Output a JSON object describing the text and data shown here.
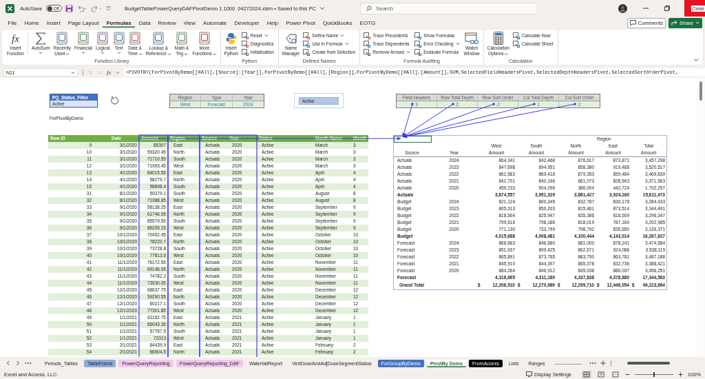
{
  "title_bar": {
    "autosave": {
      "label": "AutoSave",
      "on": false,
      "state": "Off"
    },
    "document_title": "BudgetTablePowerQueryDAFPivotDemo 1.1000  04272024.xlsm • Saved to this PC",
    "search": {
      "placeholder": "Search"
    },
    "close_label": "Close"
  },
  "menu": {
    "tabs": [
      {
        "label": "File",
        "selected": false
      },
      {
        "label": "Home",
        "selected": false
      },
      {
        "label": "Insert",
        "selected": false
      },
      {
        "label": "Page Layout",
        "selected": false
      },
      {
        "label": "Formulas",
        "selected": true
      },
      {
        "label": "Data",
        "selected": false
      },
      {
        "label": "Review",
        "selected": false
      },
      {
        "label": "View",
        "selected": false
      },
      {
        "label": "Automate",
        "selected": false
      },
      {
        "label": "Developer",
        "selected": false
      },
      {
        "label": "Help",
        "selected": false
      },
      {
        "label": "Power Pivot",
        "selected": false
      },
      {
        "label": "QuickBooks",
        "selected": false
      },
      {
        "label": "EOTG",
        "selected": false
      }
    ],
    "comments": "Comments",
    "share": "Share"
  },
  "ribbon": {
    "groups": [
      {
        "label": "Function Library",
        "items": [
          {
            "kind": "large",
            "lines": [
              "Insert",
              "Function"
            ],
            "dropdown": false,
            "icon_text": "fx"
          },
          {
            "kind": "large",
            "lines": [
              "AutoSum"
            ],
            "dropdown": true
          },
          {
            "kind": "large",
            "lines": [
              "Recently",
              "Used"
            ],
            "dropdown": true
          },
          {
            "kind": "large",
            "lines": [
              "Financial"
            ],
            "dropdown": true
          },
          {
            "kind": "large",
            "lines": [
              "Logical"
            ],
            "dropdown": true
          },
          {
            "kind": "large",
            "lines": [
              "Text"
            ],
            "dropdown": true
          },
          {
            "kind": "large",
            "lines": [
              "Date &",
              "Time"
            ],
            "dropdown": true
          },
          {
            "kind": "large",
            "lines": [
              "Lookup &",
              "Reference"
            ],
            "dropdown": true
          },
          {
            "kind": "large",
            "lines": [
              "Math &",
              "Trig"
            ],
            "dropdown": true
          },
          {
            "kind": "large",
            "lines": [
              "More",
              "Functions"
            ],
            "dropdown": true
          }
        ]
      },
      {
        "label": "Python",
        "items": [
          {
            "kind": "large",
            "lines": [
              "Insert",
              "Python"
            ],
            "dropdown": false
          },
          {
            "kind": "column",
            "buttons": [
              {
                "label": "Reset",
                "dropdown": true
              },
              {
                "label": "Diagnostics",
                "dropdown": false
              },
              {
                "label": "Initialization",
                "dropdown": false
              }
            ]
          }
        ]
      },
      {
        "label": "Defined Names",
        "items": [
          {
            "kind": "large",
            "lines": [
              "Name",
              "Manager"
            ],
            "dropdown": false
          },
          {
            "kind": "column",
            "buttons": [
              {
                "label": "Define Name",
                "dropdown": true
              },
              {
                "label": "Use in Formula",
                "dropdown": true
              },
              {
                "label": "Create from Selection",
                "dropdown": false
              }
            ]
          }
        ]
      },
      {
        "label": "Formula Auditing",
        "items": [
          {
            "kind": "column",
            "buttons": [
              {
                "label": "Trace Precedents",
                "dropdown": false
              },
              {
                "label": "Trace Dependents",
                "dropdown": false
              },
              {
                "label": "Remove Arrows",
                "dropdown": true
              }
            ]
          },
          {
            "kind": "column",
            "buttons": [
              {
                "label": "Show Formulas",
                "dropdown": false
              },
              {
                "label": "Error Checking",
                "dropdown": true
              },
              {
                "label": "Evaluate Formula",
                "dropdown": false
              }
            ]
          },
          {
            "kind": "large",
            "lines": [
              "Watch",
              "Window"
            ],
            "dropdown": false
          }
        ]
      },
      {
        "label": "Calculation",
        "items": [
          {
            "kind": "large",
            "lines": [
              "Calculation",
              "Options"
            ],
            "dropdown": true
          },
          {
            "kind": "column",
            "buttons": [
              {
                "label": "Calculate Now",
                "dropdown": false
              },
              {
                "label": "Calculate Sheet",
                "dropdown": false
              }
            ]
          }
        ]
      }
    ]
  },
  "formula_bar": {
    "name_box": "N11",
    "fx": "fx",
    "formula": "=PIVOTBY(ForPivotByDemo[[#All],[Source]:[Year]],ForPivotByDemo[[#All],[Region]],ForPivotByDemo[[#All],[Amount]],SUM,SelectedFieldHeadersPivot,SelectedDepthHeadersPivot,SelectedSortOrderPivot,"
  },
  "sheet": {
    "status_filter": {
      "header": "PQ_Status_Filter",
      "value": "Active"
    },
    "selector": {
      "columns": [
        "Region",
        "Type",
        "Year"
      ],
      "values": [
        "West",
        "Forecast",
        "2024"
      ]
    },
    "slicer": {
      "items": [
        {
          "label": "Active",
          "selected": true
        }
      ]
    },
    "pivot_settings": {
      "columns": [
        "Field Headers",
        "Row Total Depth",
        "Row Sort Order",
        "Col Total Depth",
        "Col Sort Order"
      ],
      "values": [
        "3",
        "2",
        "-2",
        "1",
        "2"
      ]
    },
    "table_name": "ForPivotByDemo",
    "table": {
      "columns": [
        "Row ID",
        "Date",
        "Amount",
        "Region",
        "Source",
        "Year",
        "Status",
        "Month Name",
        "Month"
      ],
      "rows": [
        [
          "9",
          "3/1/2020",
          "85307",
          "East",
          "Actuals",
          "2020",
          "Active",
          "March",
          "3"
        ],
        [
          "10",
          "3/1/2020",
          "59320.45",
          "North",
          "Actuals",
          "2020",
          "Active",
          "March",
          "3"
        ],
        [
          "11",
          "3/1/2020",
          "71710.55",
          "South",
          "Actuals",
          "2020",
          "Active",
          "March",
          "3"
        ],
        [
          "12",
          "3/1/2020",
          "71993.45",
          "West",
          "Actuals",
          "2020",
          "Active",
          "March",
          "3"
        ],
        [
          "13",
          "4/1/2020",
          "84015.55",
          "East",
          "Actuals",
          "2020",
          "Active",
          "April",
          "4"
        ],
        [
          "14",
          "4/1/2020",
          "58279.7",
          "North",
          "Actuals",
          "2020",
          "Active",
          "April",
          "4"
        ],
        [
          "15",
          "4/1/2020",
          "58898.4",
          "South",
          "Actuals",
          "2020",
          "Active",
          "April",
          "4"
        ],
        [
          "31",
          "8/1/2020",
          "59379.1",
          "South",
          "Actuals",
          "2020",
          "Active",
          "August",
          "8"
        ],
        [
          "32",
          "8/1/2020",
          "71988.85",
          "West",
          "Actuals",
          "2020",
          "Active",
          "August",
          "8"
        ],
        [
          "33",
          "9/1/2020",
          "58138.25",
          "East",
          "Actuals",
          "2020",
          "Active",
          "September",
          "9"
        ],
        [
          "34",
          "9/1/2020",
          "61746.95",
          "North",
          "Actuals",
          "2020",
          "Active",
          "September",
          "9"
        ],
        [
          "35",
          "9/1/2020",
          "85579.55",
          "South",
          "Actuals",
          "2020",
          "Active",
          "September",
          "9"
        ],
        [
          "36",
          "9/1/2020",
          "86205.15",
          "West",
          "Actuals",
          "2020",
          "Active",
          "September",
          "9"
        ],
        [
          "37",
          "10/1/2020",
          "70452.45",
          "East",
          "Actuals",
          "2020",
          "Active",
          "October",
          "10"
        ],
        [
          "38",
          "10/1/2020",
          "78220.7",
          "North",
          "Actuals",
          "2020",
          "Active",
          "October",
          "10"
        ],
        [
          "39",
          "10/1/2020",
          "73728.8",
          "South",
          "Actuals",
          "2020",
          "Active",
          "October",
          "10"
        ],
        [
          "40",
          "10/1/2020",
          "77813.6",
          "West",
          "Actuals",
          "2020",
          "Active",
          "October",
          "10"
        ],
        [
          "41",
          "11/1/2020",
          "76172.55",
          "East",
          "Actuals",
          "2020",
          "Active",
          "November",
          "11"
        ],
        [
          "42",
          "11/1/2020",
          "69146.05",
          "North",
          "Actuals",
          "2020",
          "Active",
          "November",
          "11"
        ],
        [
          "43",
          "11/1/2020",
          "74782.2",
          "South",
          "Actuals",
          "2020",
          "Active",
          "November",
          "11"
        ],
        [
          "44",
          "11/1/2020",
          "73930.05",
          "West",
          "Actuals",
          "2020",
          "Active",
          "November",
          "11"
        ],
        [
          "45",
          "12/1/2020",
          "68637.75",
          "East",
          "Actuals",
          "2020",
          "Active",
          "December",
          "12"
        ],
        [
          "46",
          "12/1/2020",
          "59290.55",
          "North",
          "Actuals",
          "2020",
          "Active",
          "December",
          "12"
        ],
        [
          "47",
          "12/1/2020",
          "80217.1",
          "South",
          "Actuals",
          "2020",
          "Active",
          "December",
          "12"
        ],
        [
          "48",
          "12/1/2020",
          "77301.85",
          "West",
          "Actuals",
          "2020",
          "Active",
          "December",
          "12"
        ],
        [
          "49",
          "1/1/2021",
          "61162.75",
          "East",
          "Actuals",
          "2021",
          "Active",
          "January",
          "1"
        ],
        [
          "50",
          "1/1/2021",
          "66043.35",
          "North",
          "Actuals",
          "2021",
          "Active",
          "January",
          "1"
        ],
        [
          "51",
          "1/1/2021",
          "57787.5",
          "South",
          "Actuals",
          "2021",
          "Active",
          "January",
          "1"
        ],
        [
          "52",
          "1/1/2021",
          "72013",
          "West",
          "Actuals",
          "2021",
          "Active",
          "January",
          "1"
        ],
        [
          "53",
          "2/1/2021",
          "84439.9",
          "East",
          "Actuals",
          "2021",
          "Active",
          "February",
          "2"
        ],
        [
          "54",
          "2/1/2021",
          "66504.5",
          "North",
          "Actuals",
          "2021",
          "Active",
          "February",
          "2"
        ]
      ]
    },
    "pivot": {
      "column_group": "Region",
      "columns": [
        "West",
        "South",
        "North",
        "East",
        "Total"
      ],
      "row_fields": [
        "Source",
        "Year"
      ],
      "measures": [
        "Amount",
        "Amount",
        "Amount",
        "Amount",
        "Amount"
      ],
      "rows": [
        {
          "kind": "detail",
          "source": "Actuals",
          "year": "2024",
          "amounts": [
            "864,341",
            "842,468",
            "876,617",
            "873,871",
            "3,457,298"
          ]
        },
        {
          "kind": "detail",
          "source": "Actuals",
          "year": "2023",
          "amounts": [
            "847,698",
            "894,951",
            "858,380",
            "919,488",
            "3,520,517"
          ]
        },
        {
          "kind": "detail",
          "source": "Actuals",
          "year": "2022",
          "amounts": [
            "861,583",
            "869,418",
            "879,353",
            "859,484",
            "3,469,839"
          ]
        },
        {
          "kind": "detail",
          "source": "Actuals",
          "year": "2021",
          "amounts": [
            "841,701",
            "840,196",
            "861,073",
            "828,593",
            "3,371,563"
          ]
        },
        {
          "kind": "detail",
          "source": "Actuals",
          "year": "2020",
          "amounts": [
            "459,233",
            "504,296",
            "386,004",
            "442,724",
            "1,792,257"
          ]
        },
        {
          "kind": "subtotal",
          "source": "Actuals",
          "amounts": [
            "3,874,557",
            "3,951,329",
            "3,861,427",
            "3,924,160",
            "15,611,473"
          ]
        },
        {
          "kind": "detail",
          "source": "Budget",
          "year": "2024",
          "amounts": [
            "821,124",
            "800,345",
            "832,787",
            "830,178",
            "3,284,433"
          ]
        },
        {
          "kind": "detail",
          "source": "Budget",
          "year": "2023",
          "amounts": [
            "805,313",
            "850,203",
            "815,461",
            "873,514",
            "3,344,491"
          ]
        },
        {
          "kind": "detail",
          "source": "Budget",
          "year": "2022",
          "amounts": [
            "818,504",
            "825,947",
            "835,386",
            "816,509",
            "3,296,347"
          ]
        },
        {
          "kind": "detail",
          "source": "Budget",
          "year": "2021",
          "amounts": [
            "799,616",
            "798,186",
            "818,019",
            "787,164",
            "3,202,985"
          ]
        },
        {
          "kind": "detail",
          "source": "Budget",
          "year": "2020",
          "amounts": [
            "771,130",
            "733,799",
            "798,792",
            "835,650",
            "3,139,371"
          ]
        },
        {
          "kind": "subtotal",
          "source": "Budget",
          "amounts": [
            "4,015,688",
            "4,008,481",
            "4,100,444",
            "4,143,014",
            "16,267,627"
          ]
        },
        {
          "kind": "detail",
          "source": "Forecast",
          "year": "2024",
          "amounts": [
            "868,663",
            "846,680",
            "881,000",
            "878,241",
            "3,474,584"
          ]
        },
        {
          "kind": "detail",
          "source": "Forecast",
          "year": "2023",
          "amounts": [
            "851,937",
            "899,425",
            "862,671",
            "924,086",
            "3,538,119"
          ]
        },
        {
          "kind": "detail",
          "source": "Forecast",
          "year": "2022",
          "amounts": [
            "865,891",
            "873,765",
            "883,750",
            "863,781",
            "3,487,188"
          ]
        },
        {
          "kind": "detail",
          "source": "Forecast",
          "year": "2021",
          "amounts": [
            "845,910",
            "844,397",
            "865,378",
            "832,736",
            "3,388,421"
          ]
        },
        {
          "kind": "detail",
          "source": "Forecast",
          "year": "2020",
          "amounts": [
            "884,264",
            "846,912",
            "845,038",
            "880,037",
            "3,456,251"
          ]
        },
        {
          "kind": "subtotal",
          "source": "Forecast",
          "amounts": [
            "4,316,665",
            "4,311,180",
            "4,337,838",
            "4,378,880",
            "17,344,563"
          ]
        },
        {
          "kind": "grand",
          "source": "Grand Total",
          "currency": "$",
          "amounts": [
            "12,206,910",
            "12,270,989",
            "12,299,710",
            "12,446,054",
            "49,223,664"
          ]
        }
      ]
    }
  },
  "sheet_tabs": {
    "tabs": [
      {
        "label": "Periods_Tables",
        "selected": false
      },
      {
        "label": "TableForms",
        "selected": false,
        "color": "#8eaadb"
      },
      {
        "label": "PowerQueryReporting",
        "selected": false,
        "color": "#f4c6f2"
      },
      {
        "label": "PowerQueryReporting_DAF",
        "selected": false,
        "color": "#f4c6f2"
      },
      {
        "label": "WaterfallReport",
        "selected": false
      },
      {
        "label": "VertDoseAndAdjDoseSegmentStatus",
        "selected": false
      },
      {
        "label": "ForGroupByDemo",
        "selected": false,
        "color": "#4472c4"
      },
      {
        "label": "PivotBy Demo",
        "selected": true
      },
      {
        "label": "FromAccess",
        "selected": false,
        "color": "#000000"
      },
      {
        "label": "Lists",
        "selected": false
      },
      {
        "label": "Ranges",
        "selected": false
      },
      {
        "label": "-----------------",
        "selected": false
      }
    ]
  },
  "status_bar": {
    "text": "Excel and Access, LLC.",
    "display_settings": "Display Settings",
    "views": [
      {
        "selected": true
      },
      {
        "selected": false
      },
      {
        "selected": false
      }
    ],
    "zoom": {
      "level": 0.5,
      "reading": "100%"
    }
  }
}
